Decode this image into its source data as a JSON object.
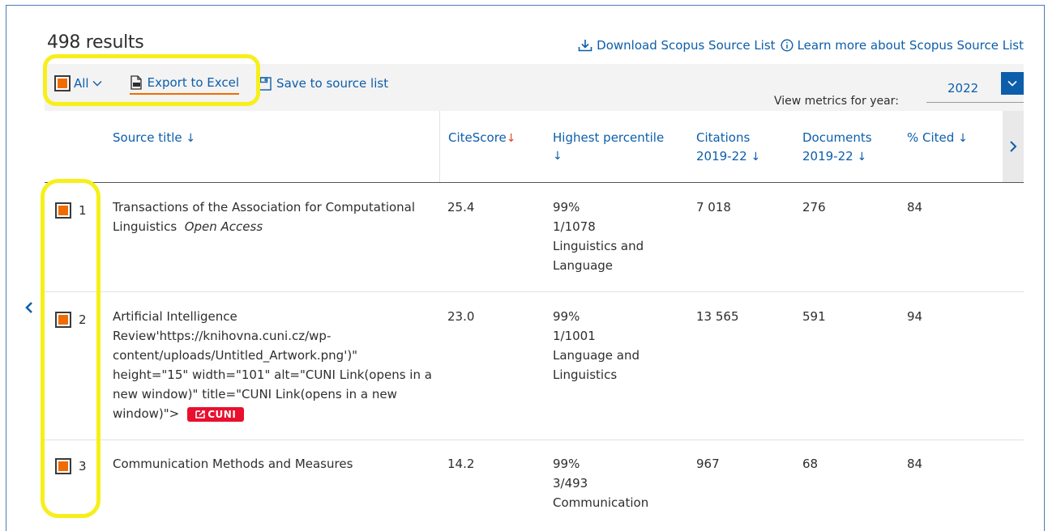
{
  "results": {
    "count_label": "498 results"
  },
  "top_links": {
    "download": "Download Scopus Source List",
    "learn_more": "Learn more about Scopus Source List"
  },
  "toolbar": {
    "all_label": "All",
    "export_label": "Export to Excel",
    "save_label": "Save to source list",
    "view_metrics_label": "View metrics for year:",
    "year_value": "2022"
  },
  "columns": {
    "source_title": "Source title",
    "citescore": "CiteScore",
    "highest_percentile": "Highest percentile",
    "citations_l1": "Citations",
    "citations_l2": "2019-22",
    "documents_l1": "Documents",
    "documents_l2": "2019-22",
    "cited": "% Cited"
  },
  "rows": [
    {
      "index": "1",
      "title": "Transactions of the Association for Computational Linguistics",
      "badge": "Open Access",
      "citescore": "25.4",
      "percentile": "99%",
      "rank": "1/1078",
      "category": "Linguistics and Language",
      "citations": "7 018",
      "documents": "276",
      "cited": "84"
    },
    {
      "index": "2",
      "title": "Artificial Intelligence Review'https://knihovna.cuni.cz/wp-content/uploads/Untitled_Artwork.png')\" height=\"15\" width=\"101\" alt=\"CUNI Link(opens in a new window)\" title=\"CUNI Link(opens in a new window)\">",
      "link_badge": "CUNI",
      "citescore": "23.0",
      "percentile": "99%",
      "rank": "1/1001",
      "category": "Language and Linguistics",
      "citations": "13 565",
      "documents": "591",
      "cited": "94"
    },
    {
      "index": "3",
      "title": "Communication Methods and Measures",
      "citescore": "14.2",
      "percentile": "99%",
      "rank": "3/493",
      "category": "Communication",
      "citations": "967",
      "documents": "68",
      "cited": "84"
    }
  ],
  "icons": {
    "download": "download-icon",
    "info": "info-icon",
    "export": "excel-file-icon",
    "save": "save-icon",
    "dropdown": "chevron-down-icon",
    "scroll": "chevron-right-icon",
    "collapse": "arrow-left-icon"
  },
  "colors": {
    "accent": "#0c5eab",
    "checkbox_fill": "#ef6c00",
    "highlight": "#f7ef1a",
    "cuni_red": "#e8102e"
  }
}
